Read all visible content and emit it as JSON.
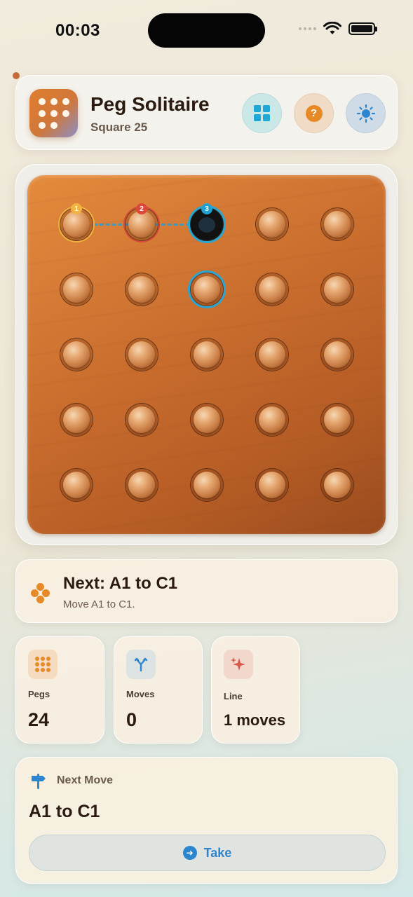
{
  "status_bar": {
    "time": "00:03"
  },
  "header": {
    "title": "Peg Solitaire",
    "subtitle": "Square 25",
    "buttons": {
      "grid": "grid-icon",
      "help": "?",
      "theme": "sun-icon"
    }
  },
  "board": {
    "columns": 5,
    "rows": 5,
    "empty_holes": [
      [
        0,
        2
      ]
    ],
    "highlights": [
      {
        "row": 0,
        "col": 0,
        "color": "#f2b440",
        "badge": "1"
      },
      {
        "row": 0,
        "col": 1,
        "color": "#d94a3a",
        "badge": "2"
      },
      {
        "row": 0,
        "col": 2,
        "color": "#28a6d4",
        "badge": "3"
      },
      {
        "row": 1,
        "col": 2,
        "color": "#28a6d4",
        "badge": ""
      }
    ]
  },
  "next_hint": {
    "title": "Next: A1 to C1",
    "subtitle": "Move A1 to C1."
  },
  "stats": [
    {
      "label": "Pegs",
      "value": "24",
      "icon": "pegs-icon"
    },
    {
      "label": "Moves",
      "value": "0",
      "icon": "fork-icon"
    },
    {
      "label": "Line",
      "value": "1 moves",
      "icon": "sparkle-icon"
    }
  ],
  "next_move": {
    "label": "Next Move",
    "value": "A1 to C1",
    "button_label": "Take"
  },
  "colors": {
    "accent_orange": "#e58a26",
    "accent_blue": "#2c86cf",
    "board_wood": "#c96d2e"
  }
}
